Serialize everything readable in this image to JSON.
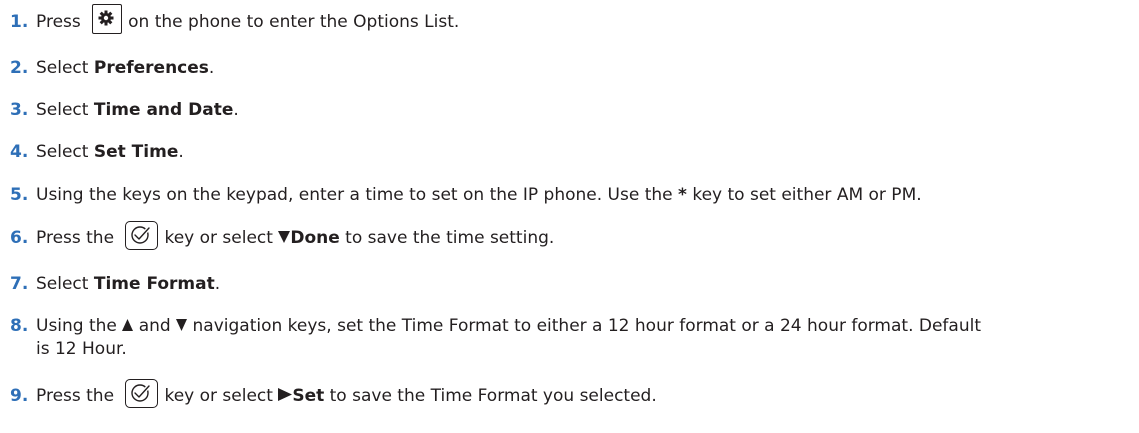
{
  "steps": [
    {
      "num": "1.",
      "before": "Press",
      "after": "on the phone to enter the Options List."
    },
    {
      "num": "2.",
      "before": "Select ",
      "bold": "Preferences",
      "after": "."
    },
    {
      "num": "3.",
      "before": "Select ",
      "bold": "Time and Date",
      "after": "."
    },
    {
      "num": "4.",
      "before": "Select ",
      "bold": "Set Time",
      "after": "."
    },
    {
      "num": "5.",
      "before": "Using the keys on the keypad, enter a time to set on the IP phone. Use the ",
      "bold": "*",
      "after": " key to set either AM or PM."
    },
    {
      "num": "6.",
      "before": "Press the",
      "middle": "key or select ",
      "bold": "Done",
      "after": " to save the time setting."
    },
    {
      "num": "7.",
      "before": "Select ",
      "bold": "Time Format",
      "after": "."
    },
    {
      "num": "8.",
      "before": "Using the",
      "middle": "and",
      "after_line1": "navigation keys, set the Time Format to either a 12 hour format or a 24 hour format. Default",
      "line2": "is 12 Hour."
    },
    {
      "num": "9.",
      "before": "Press the",
      "middle": "key or select ",
      "bold": "Set",
      "after": " to save the Time Format you selected."
    }
  ],
  "icons": {
    "options_key": "gear-icon",
    "enter_key": "checkmark-icon",
    "done_softkey": "triangle-down-icon",
    "set_softkey": "triangle-right-icon",
    "nav_up": "triangle-up-icon",
    "nav_down": "triangle-down-icon"
  },
  "colors": {
    "step_number": "#2e6fb7",
    "text": "#231f20"
  }
}
